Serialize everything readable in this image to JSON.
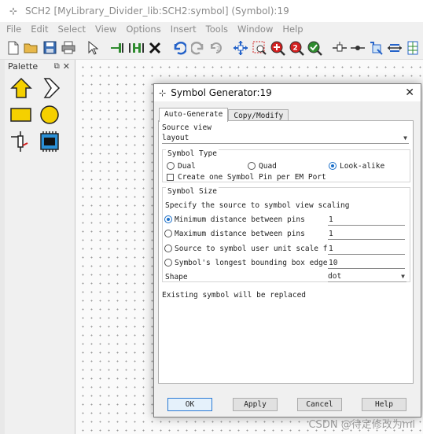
{
  "window": {
    "title": "SCH2 [MyLibrary_Divider_lib:SCH2:symbol] (Symbol):19"
  },
  "menubar": [
    "File",
    "Edit",
    "Select",
    "View",
    "Options",
    "Insert",
    "Tools",
    "Window",
    "Help"
  ],
  "toolbar": {
    "icons": [
      "new-file-icon",
      "open-folder-icon",
      "save-icon",
      "print-icon",
      "select-arrow-icon",
      "pin-left-icon",
      "pin-pair-icon",
      "delete-x-icon",
      "undo-icon",
      "redo-icon",
      "recompile-icon",
      "move-icon",
      "zoom-box-icon",
      "zoom-in-icon",
      "zoom-out-icon",
      "zoom-fit-icon",
      "wire-icon",
      "port-icon",
      "align-icon",
      "resize-icon"
    ]
  },
  "palette": {
    "title": "Palette",
    "items": [
      "pin-up-icon",
      "pin-diagonal-icon",
      "rectangle-shape-icon",
      "circle-shape-icon",
      "pin-component-icon",
      "chip-component-icon"
    ]
  },
  "dialog": {
    "title": "Symbol Generator:19",
    "tabs": [
      {
        "label": "Auto-Generate",
        "active": true
      },
      {
        "label": "Copy/Modify",
        "active": false
      }
    ],
    "source_view": {
      "label": "Source view",
      "value": "layout"
    },
    "symbol_type": {
      "label": "Symbol Type",
      "options": [
        {
          "label": "Dual",
          "selected": false
        },
        {
          "label": "Quad",
          "selected": false
        },
        {
          "label": "Look-alike",
          "selected": true
        }
      ],
      "per_port_checkbox": {
        "label": "Create one Symbol Pin per EM Port",
        "checked": false
      }
    },
    "symbol_size": {
      "label": "Symbol Size",
      "instruction": "Specify the source to symbol view scaling",
      "options": [
        {
          "label": "Minimum distance between pins",
          "value": "1",
          "selected": true
        },
        {
          "label": "Maximum distance between pins",
          "value": "1",
          "selected": false
        },
        {
          "label": "Source to symbol user unit scale factor",
          "value": "1",
          "selected": false
        },
        {
          "label": "Symbol's longest bounding box edge",
          "value": "10",
          "selected": false
        }
      ],
      "shape": {
        "label": "Shape",
        "value": "dot"
      }
    },
    "status": "Existing symbol will be replaced",
    "buttons": {
      "ok": "OK",
      "apply": "Apply",
      "cancel": "Cancel",
      "help": "Help"
    }
  },
  "watermark": "CSDN @待定修改为ml",
  "colors": {
    "accent": "#1a6fc9",
    "palette_fill": "#f5d000",
    "toolbar_green": "#2e8b2e",
    "toolbar_red": "#d22020"
  }
}
